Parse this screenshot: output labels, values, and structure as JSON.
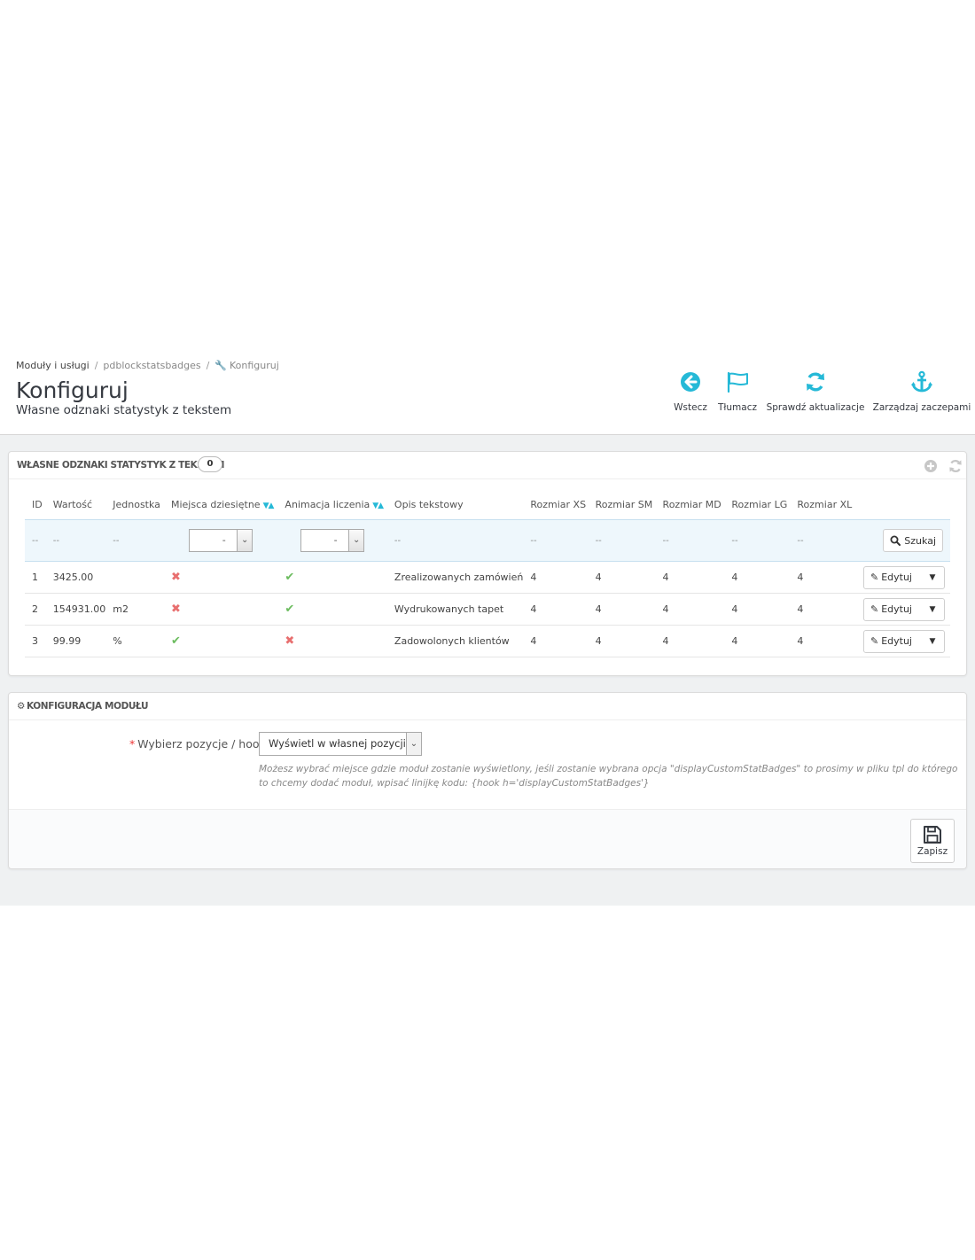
{
  "breadcrumb": {
    "items": [
      "Moduły i usługi",
      "pdblockstatsbadges",
      "Konfiguruj"
    ]
  },
  "header": {
    "title": "Konfiguruj",
    "subtitle": "Własne odznaki statystyk z tekstem"
  },
  "toolbar": {
    "back": "Wstecz",
    "translate": "Tłumacz",
    "check_updates": "Sprawdź aktualizacje",
    "manage_hooks": "Zarządzaj zaczepami"
  },
  "list_panel": {
    "title": "WŁASNE ODZNAKI STATYSTYK Z TEKSTEM",
    "count": "0",
    "columns": [
      "ID",
      "Wartość",
      "Jednostka",
      "Miejsca dziesiętne",
      "Animacja liczenia",
      "Opis tekstowy",
      "Rozmiar XS",
      "Rozmiar SM",
      "Rozmiar MD",
      "Rozmiar LG",
      "Rozmiar XL"
    ],
    "filter_placeholder": "--",
    "filter_select_value": "-",
    "search_label": "Szukaj",
    "edit_label": "Edytuj",
    "rows": [
      {
        "id": "1",
        "value": "3425.00",
        "unit": "",
        "decimals": false,
        "animation": true,
        "text": "Zrealizowanych zamówień",
        "xs": "4",
        "sm": "4",
        "md": "4",
        "lg": "4",
        "xl": "4"
      },
      {
        "id": "2",
        "value": "154931.00",
        "unit": "m2",
        "decimals": false,
        "animation": true,
        "text": "Wydrukowanych tapet",
        "xs": "4",
        "sm": "4",
        "md": "4",
        "lg": "4",
        "xl": "4"
      },
      {
        "id": "3",
        "value": "99.99",
        "unit": "%",
        "decimals": true,
        "animation": false,
        "text": "Zadowolonych klientów",
        "xs": "4",
        "sm": "4",
        "md": "4",
        "lg": "4",
        "xl": "4"
      }
    ]
  },
  "config_panel": {
    "title": "KONFIGURACJA MODUŁU",
    "required_mark": "*",
    "hook_label": "Wybierz pozycje / hook",
    "hook_value": "Wyświetl w własnej pozycji (d",
    "help_text": "Możesz wybrać miejsce gdzie moduł zostanie wyświetlony, jeśli zostanie wybrana opcja \"displayCustomStatBadges\" to prosimy w pliku tpl do którego to chcemy dodać moduł, wpisać linijkę kodu: {hook h='displayCustomStatBadges'}",
    "save_label": "Zapisz"
  },
  "colors": {
    "accent": "#25b9d7",
    "error": "#e86f6f",
    "success": "#6cbc5f"
  }
}
